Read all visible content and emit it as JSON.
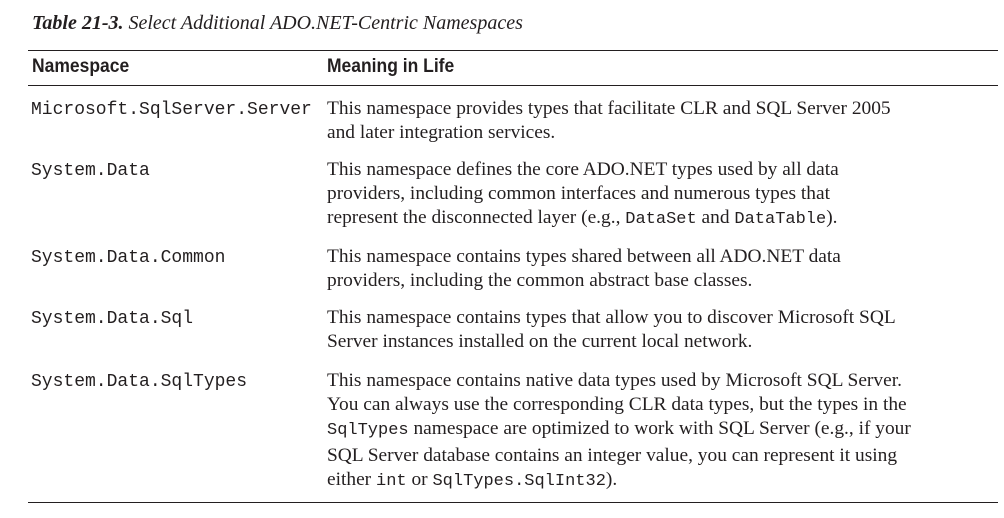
{
  "caption": {
    "number": "Table 21-3.",
    "title": "Select Additional ADO.NET-Centric Namespaces"
  },
  "table": {
    "headers": [
      "Namespace",
      "Meaning in Life"
    ],
    "rows": [
      {
        "namespace": "Microsoft.SqlServer.Server",
        "meaning": [
          "This namespace provides types that facilitate CLR and SQL Server 2005",
          "and later integration services."
        ]
      },
      {
        "namespace": "System.Data",
        "meaning": [
          "This namespace defines the core ADO.NET types used by all data",
          "providers, including common interfaces and numerous types that",
          [
            "represent the disconnected layer (e.g., ",
            "DataSet",
            " and ",
            "DataTable",
            ")."
          ]
        ]
      },
      {
        "namespace": "System.Data.Common",
        "meaning": [
          "This namespace contains types shared between all ADO.NET data",
          "providers, including the common abstract base classes."
        ]
      },
      {
        "namespace": "System.Data.Sql",
        "meaning": [
          "This namespace contains types that allow you to discover Microsoft SQL",
          "Server instances installed on the current local network."
        ]
      },
      {
        "namespace": "System.Data.SqlTypes",
        "meaning": [
          "This namespace contains native data types used by Microsoft SQL Server.",
          "You can always use the corresponding CLR data types, but the types in the",
          [
            "",
            "SqlTypes",
            " namespace are optimized to work with SQL Server (e.g., if your"
          ],
          "SQL Server database contains an integer value, you can represent it using",
          [
            "either ",
            "int",
            " or ",
            "SqlTypes.SqlInt32",
            ")."
          ]
        ]
      }
    ]
  }
}
